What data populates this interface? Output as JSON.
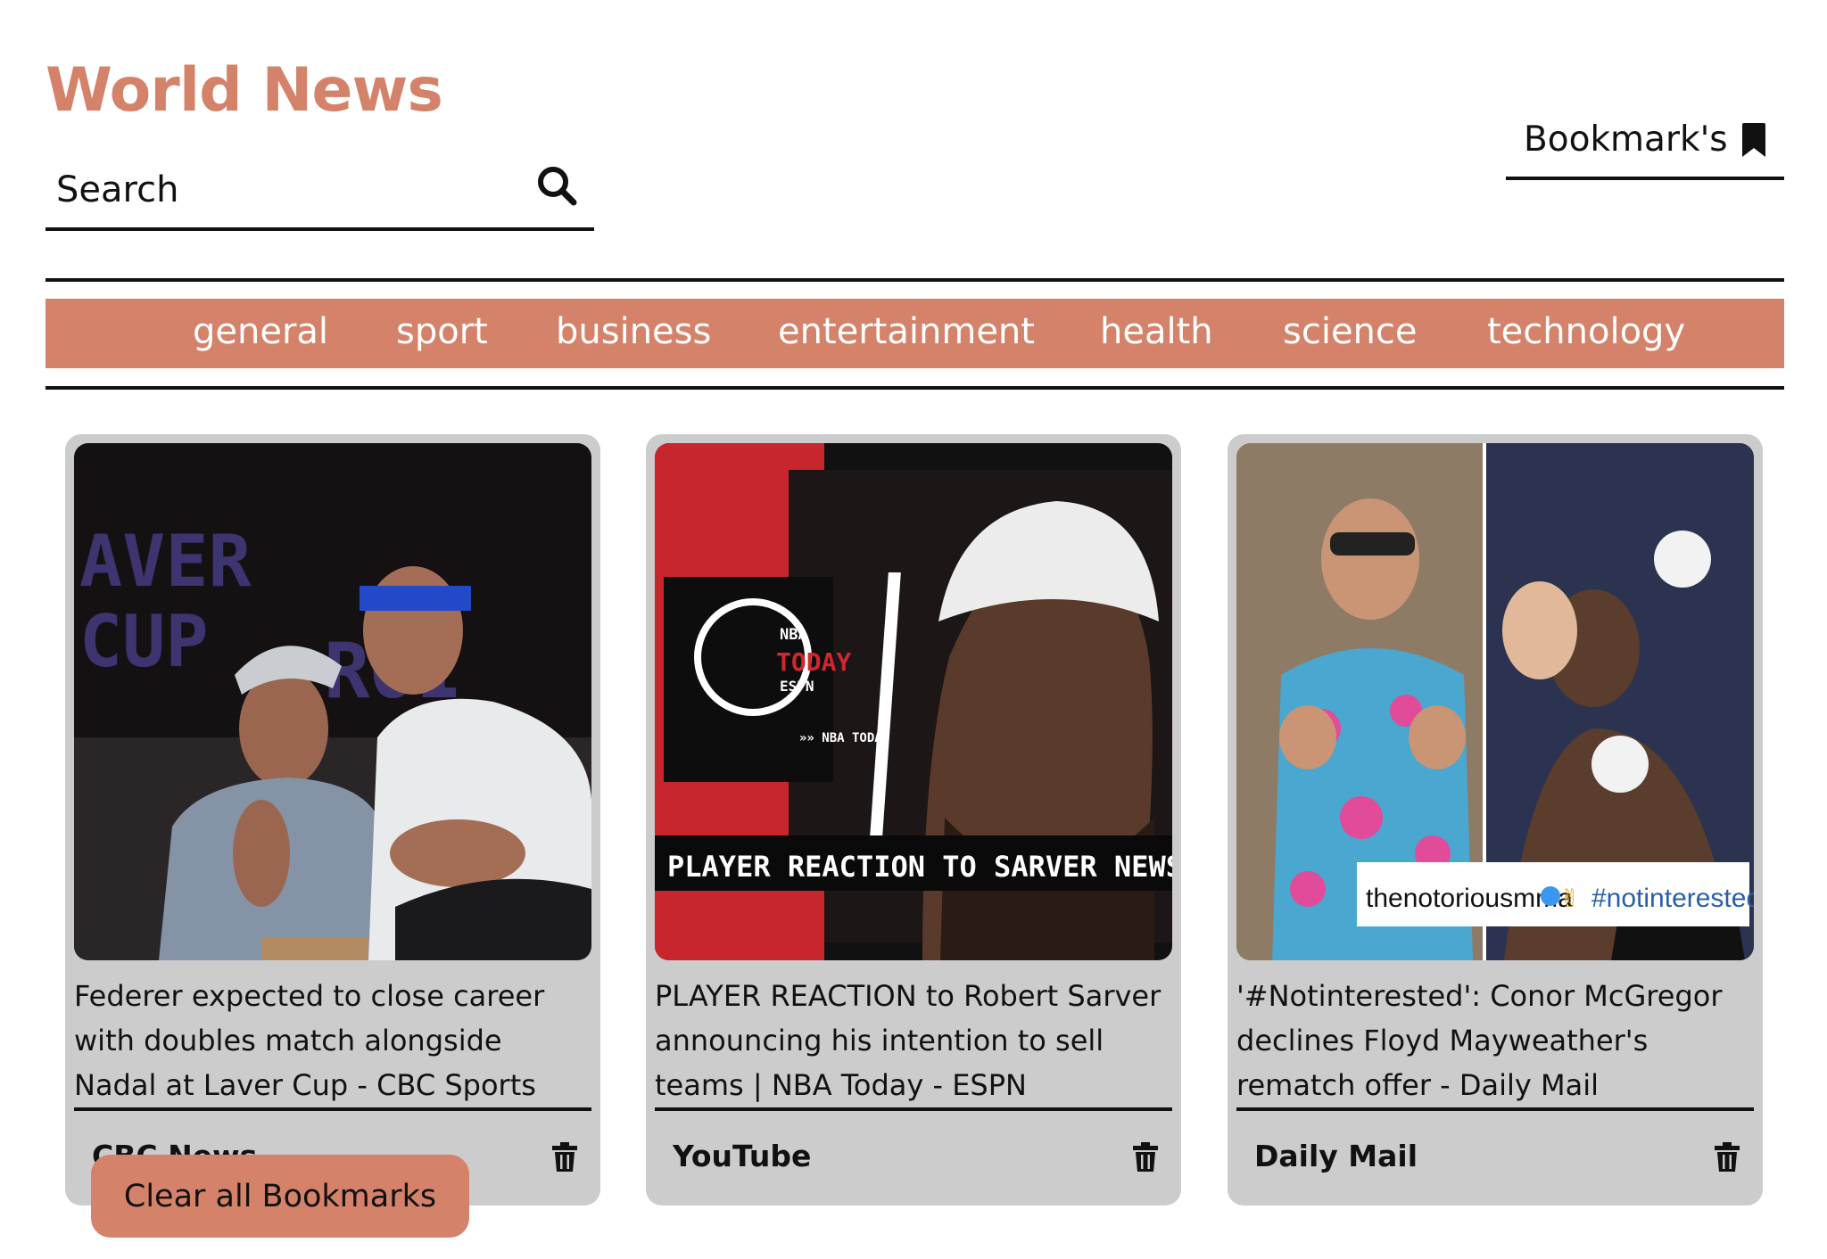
{
  "app": {
    "title": "World News"
  },
  "search": {
    "placeholder": "Search",
    "value": ""
  },
  "bookmarks_link": {
    "label": "Bookmark's"
  },
  "categories": [
    "general",
    "sport",
    "business",
    "entertainment",
    "health",
    "science",
    "technology"
  ],
  "cards": [
    {
      "headline": "Federer expected to close career with doubles match alongside Nadal at Laver Cup - CBC Sports",
      "source": "CBC News",
      "image_text": [
        "AVER",
        "CUP",
        "ROI"
      ]
    },
    {
      "headline": "PLAYER REACTION to Robert Sarver announcing his intention to sell teams | NBA Today - ESPN",
      "source": "YouTube",
      "image_text": [
        "NBA",
        "TODAY",
        "ESPN",
        "»» NBA TODAY",
        "PLAYER REACTION TO SARVER NEWS"
      ]
    },
    {
      "headline": "'#Notinterested': Conor McGregor declines Floyd Mayweather's rematch offer - Daily Mail",
      "source": "Daily Mail",
      "image_text": [
        "thenotoriousmma",
        "#notinterested"
      ]
    }
  ],
  "clear_button": {
    "label": "Clear all Bookmarks"
  },
  "colors": {
    "accent": "#d4826a",
    "card_bg": "#cccccc",
    "text": "#111111"
  }
}
